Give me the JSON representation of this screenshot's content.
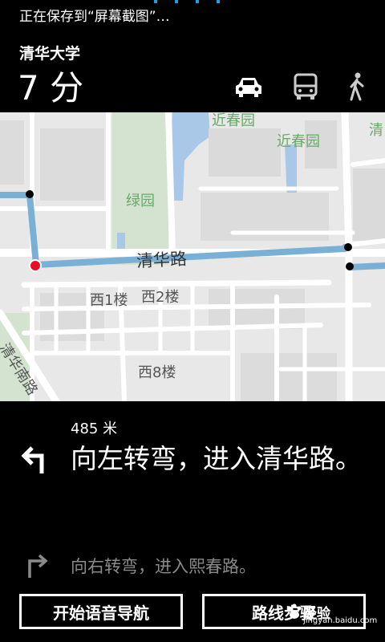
{
  "status": {
    "text": "正在保存到“屏幕截图”…"
  },
  "header": {
    "destination": "清华大学",
    "eta": "7 分"
  },
  "modes": [
    "car-icon",
    "bus-icon",
    "walk-icon"
  ],
  "map": {
    "labels": {
      "jinchunyuan_top": "近春园",
      "jinchunyuan": "近春园",
      "qing": "清",
      "lvyuan": "绿园",
      "road": "清华路",
      "xi1": "西1楼",
      "xi2": "西2楼",
      "xi8": "西8楼",
      "south_road": "清华南路"
    },
    "colors": {
      "route": "#7bb0d6",
      "start": "#e81123",
      "water": "#a9c7e6",
      "green": "#c8dcc0"
    }
  },
  "nav": {
    "distance": "485 米",
    "instruction": "向左转弯，进入清华路。",
    "next_instruction": "向右转弯，进入熙春路。"
  },
  "buttons": {
    "voice": "开始语音导航",
    "steps": "路线步骤"
  },
  "watermark": {
    "main": "经验",
    "sub": "jingyan.baidu.com"
  }
}
